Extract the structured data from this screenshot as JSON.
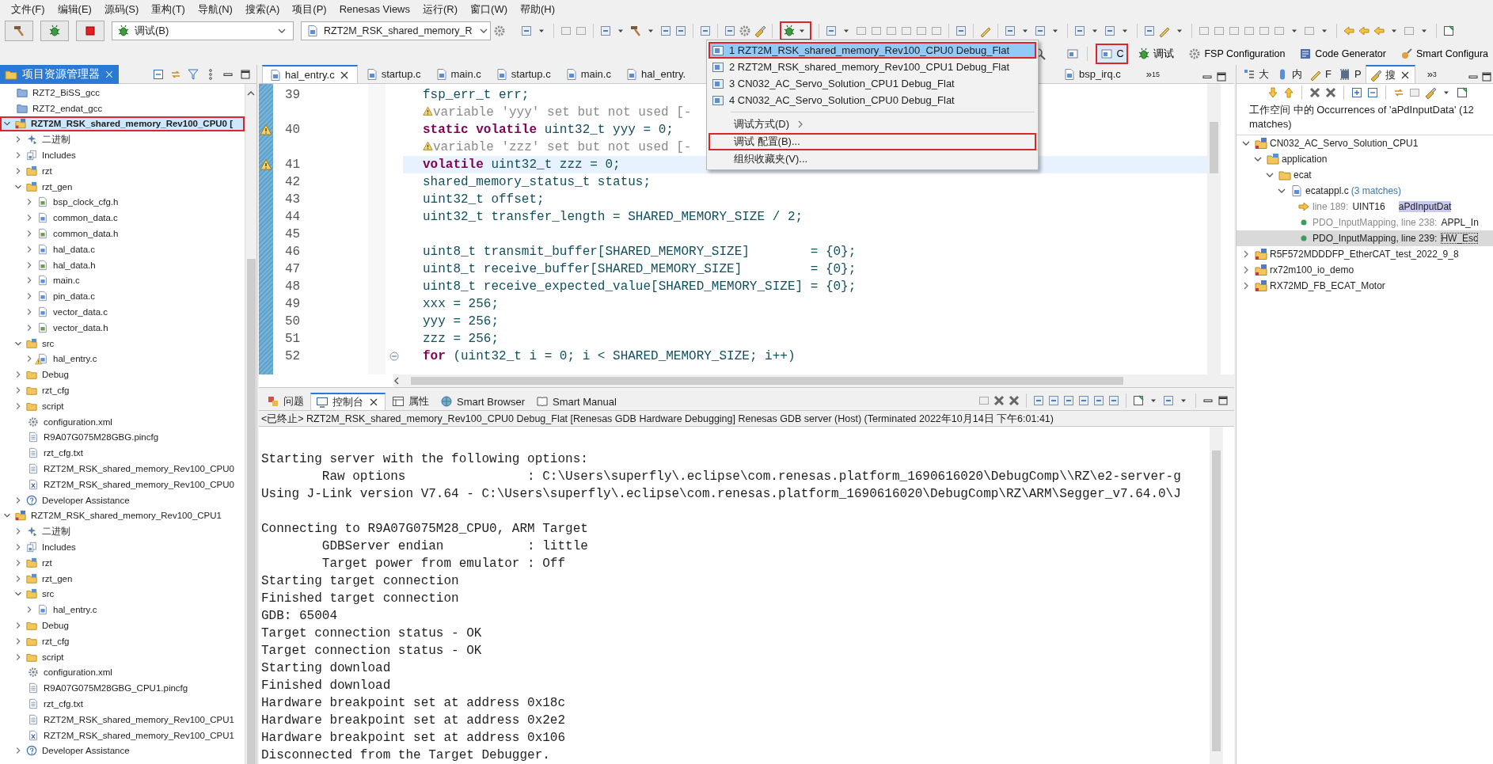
{
  "menu_bar": [
    "文件(F)",
    "编辑(E)",
    "源码(S)",
    "重构(T)",
    "导航(N)",
    "搜索(A)",
    "项目(P)",
    "Renesas Views",
    "运行(R)",
    "窗口(W)",
    "帮助(H)"
  ],
  "toolbar": {
    "launch_mode": "调试(B)",
    "launch_config": "RZT2M_RSK_shared_memory_R",
    "debug_annotated": true
  },
  "perspectives": [
    {
      "label": "C",
      "selected": true,
      "annotated": true
    },
    {
      "label": "调试",
      "selected": false,
      "annotated": false
    },
    {
      "label": "FSP Configuration",
      "selected": false,
      "annotated": false
    },
    {
      "label": "Code Generator",
      "selected": false,
      "annotated": false
    },
    {
      "label": "Smart Configura",
      "selected": false,
      "annotated": false
    }
  ],
  "project_explorer": {
    "title": "项目资源管理器",
    "items": [
      {
        "kind": "closed-project",
        "label": "RZT2_BiSS_gcc",
        "expandable": false,
        "selected": false,
        "annotated": false,
        "warning": false
      },
      {
        "kind": "closed-project",
        "label": "RZT2_endat_gcc",
        "expandable": false,
        "selected": false,
        "annotated": false,
        "warning": false
      },
      {
        "kind": "project",
        "label": "RZT2M_RSK_shared_memory_Rev100_CPU0 [",
        "expandable": true,
        "expanded": true,
        "selected": true,
        "annotated": true,
        "warning": false,
        "children": [
          {
            "kind": "binaries",
            "label": "二进制",
            "expandable": true,
            "expanded": false,
            "selected": false,
            "annotated": false,
            "warning": false
          },
          {
            "kind": "includes",
            "label": "Includes",
            "expandable": true,
            "expanded": false,
            "selected": false,
            "annotated": false,
            "warning": false
          },
          {
            "kind": "source-folder",
            "label": "rzt",
            "expandable": true,
            "expanded": false,
            "selected": false,
            "annotated": false,
            "warning": false
          },
          {
            "kind": "source-folder",
            "label": "rzt_gen",
            "expandable": true,
            "expanded": true,
            "selected": false,
            "annotated": false,
            "warning": false,
            "children": [
              {
                "kind": "h-file",
                "label": "bsp_clock_cfg.h",
                "expandable": true,
                "expanded": false,
                "selected": false,
                "annotated": false,
                "warning": false
              },
              {
                "kind": "c-file",
                "label": "common_data.c",
                "expandable": true,
                "expanded": false,
                "selected": false,
                "annotated": false,
                "warning": false
              },
              {
                "kind": "h-file",
                "label": "common_data.h",
                "expandable": true,
                "expanded": false,
                "selected": false,
                "annotated": false,
                "warning": false
              },
              {
                "kind": "c-file",
                "label": "hal_data.c",
                "expandable": true,
                "expanded": false,
                "selected": false,
                "annotated": false,
                "warning": false
              },
              {
                "kind": "h-file",
                "label": "hal_data.h",
                "expandable": true,
                "expanded": false,
                "selected": false,
                "annotated": false,
                "warning": false
              },
              {
                "kind": "c-file",
                "label": "main.c",
                "expandable": true,
                "expanded": false,
                "selected": false,
                "annotated": false,
                "warning": false
              },
              {
                "kind": "c-file",
                "label": "pin_data.c",
                "expandable": true,
                "expanded": false,
                "selected": false,
                "annotated": false,
                "warning": false
              },
              {
                "kind": "c-file",
                "label": "vector_data.c",
                "expandable": true,
                "expanded": false,
                "selected": false,
                "annotated": false,
                "warning": false
              },
              {
                "kind": "h-file",
                "label": "vector_data.h",
                "expandable": true,
                "expanded": false,
                "selected": false,
                "annotated": false,
                "warning": false
              }
            ]
          },
          {
            "kind": "source-folder",
            "label": "src",
            "expandable": true,
            "expanded": true,
            "selected": false,
            "annotated": false,
            "warning": false,
            "children": [
              {
                "kind": "c-file",
                "label": "hal_entry.c",
                "expandable": true,
                "expanded": false,
                "selected": false,
                "annotated": false,
                "warning": true
              }
            ]
          },
          {
            "kind": "folder",
            "label": "Debug",
            "expandable": true,
            "expanded": false,
            "selected": false,
            "annotated": false,
            "warning": false
          },
          {
            "kind": "folder",
            "label": "rzt_cfg",
            "expandable": true,
            "expanded": false,
            "selected": false,
            "annotated": false,
            "warning": false
          },
          {
            "kind": "folder",
            "label": "script",
            "expandable": true,
            "expanded": false,
            "selected": false,
            "annotated": false,
            "warning": false
          },
          {
            "kind": "settings-file",
            "label": "configuration.xml",
            "expandable": false,
            "selected": false,
            "annotated": false,
            "warning": false
          },
          {
            "kind": "text-file",
            "label": "R9A07G075M28GBG.pincfg",
            "expandable": false,
            "selected": false,
            "annotated": false,
            "warning": false
          },
          {
            "kind": "text-file",
            "label": "rzt_cfg.txt",
            "expandable": false,
            "selected": false,
            "annotated": false,
            "warning": false
          },
          {
            "kind": "text-file",
            "label": "RZT2M_RSK_shared_memory_Rev100_CPU0",
            "expandable": false,
            "selected": false,
            "annotated": false,
            "warning": false
          },
          {
            "kind": "xml-file",
            "label": "RZT2M_RSK_shared_memory_Rev100_CPU0",
            "expandable": false,
            "selected": false,
            "annotated": false,
            "warning": false
          },
          {
            "kind": "help",
            "label": "Developer Assistance",
            "expandable": true,
            "expanded": false,
            "selected": false,
            "annotated": false,
            "warning": false
          }
        ]
      },
      {
        "kind": "project",
        "label": "RZT2M_RSK_shared_memory_Rev100_CPU1",
        "expandable": true,
        "expanded": true,
        "selected": false,
        "annotated": false,
        "warning": false,
        "children": [
          {
            "kind": "binaries",
            "label": "二进制",
            "expandable": true,
            "expanded": false,
            "selected": false,
            "annotated": false,
            "warning": false
          },
          {
            "kind": "includes",
            "label": "Includes",
            "expandable": true,
            "expanded": false,
            "selected": false,
            "annotated": false,
            "warning": false
          },
          {
            "kind": "source-folder",
            "label": "rzt",
            "expandable": true,
            "expanded": false,
            "selected": false,
            "annotated": false,
            "warning": false
          },
          {
            "kind": "source-folder",
            "label": "rzt_gen",
            "expandable": true,
            "expanded": false,
            "selected": false,
            "annotated": false,
            "warning": false
          },
          {
            "kind": "source-folder",
            "label": "src",
            "expandable": true,
            "expanded": true,
            "selected": false,
            "annotated": false,
            "warning": false,
            "children": [
              {
                "kind": "c-file",
                "label": "hal_entry.c",
                "expandable": true,
                "expanded": false,
                "selected": false,
                "annotated": false,
                "warning": false
              }
            ]
          },
          {
            "kind": "folder",
            "label": "Debug",
            "expandable": true,
            "expanded": false,
            "selected": false,
            "annotated": false,
            "warning": false
          },
          {
            "kind": "folder",
            "label": "rzt_cfg",
            "expandable": true,
            "expanded": false,
            "selected": false,
            "annotated": false,
            "warning": false
          },
          {
            "kind": "folder",
            "label": "script",
            "expandable": true,
            "expanded": false,
            "selected": false,
            "annotated": false,
            "warning": false
          },
          {
            "kind": "settings-file",
            "label": "configuration.xml",
            "expandable": false,
            "selected": false,
            "annotated": false,
            "warning": false
          },
          {
            "kind": "text-file",
            "label": "R9A07G075M28GBG_CPU1.pincfg",
            "expandable": false,
            "selected": false,
            "annotated": false,
            "warning": false
          },
          {
            "kind": "text-file",
            "label": "rzt_cfg.txt",
            "expandable": false,
            "selected": false,
            "annotated": false,
            "warning": false
          },
          {
            "kind": "text-file",
            "label": "RZT2M_RSK_shared_memory_Rev100_CPU1",
            "expandable": false,
            "selected": false,
            "annotated": false,
            "warning": false
          },
          {
            "kind": "xml-file",
            "label": "RZT2M_RSK_shared_memory_Rev100_CPU1",
            "expandable": false,
            "selected": false,
            "annotated": false,
            "warning": false
          },
          {
            "kind": "help",
            "label": "Developer Assistance",
            "expandable": true,
            "expanded": false,
            "selected": false,
            "annotated": false,
            "warning": false
          }
        ]
      }
    ]
  },
  "editor": {
    "tabs": [
      {
        "label": "hal_entry.c",
        "selected": true
      },
      {
        "label": "startup.c",
        "selected": false
      },
      {
        "label": "main.c",
        "selected": false
      },
      {
        "label": "startup.c",
        "selected": false
      },
      {
        "label": "main.c",
        "selected": false
      },
      {
        "label": "hal_entry.",
        "selected": false
      },
      {
        "label": "bsp_irq.c",
        "selected": false
      }
    ],
    "overflow": "»",
    "overflow_count": "15",
    "lines": [
      {
        "kind": "code",
        "number": "39",
        "text": "fsp_err_t err;",
        "warning": false,
        "current": false,
        "foldable": false
      },
      {
        "kind": "annotation",
        "text": "variable 'yyy' set but not used [-"
      },
      {
        "kind": "code",
        "number": "40",
        "text": "**static volatile** uint32_t yyy = 0;",
        "warning": true,
        "current": false,
        "foldable": false
      },
      {
        "kind": "annotation",
        "text": "variable 'zzz' set but not used [-"
      },
      {
        "kind": "code",
        "number": "41",
        "text": "**volatile** uint32_t zzz = 0;",
        "warning": true,
        "current": true,
        "foldable": false
      },
      {
        "kind": "code",
        "number": "42",
        "text": "shared_memory_status_t status;",
        "warning": false,
        "current": false,
        "foldable": false
      },
      {
        "kind": "code",
        "number": "43",
        "text": "uint32_t offset;",
        "warning": false,
        "current": false,
        "foldable": false
      },
      {
        "kind": "code",
        "number": "44",
        "text": "uint32_t transfer_length = SHARED_MEMORY_SIZE / 2;",
        "warning": false,
        "current": false,
        "foldable": false
      },
      {
        "kind": "code",
        "number": "45",
        "warning": false,
        "current": false,
        "foldable": false
      },
      {
        "kind": "code",
        "number": "46",
        "text": "uint8_t transmit_buffer[SHARED_MEMORY_SIZE]        = {0};",
        "warning": false,
        "current": false,
        "foldable": false
      },
      {
        "kind": "code",
        "number": "47",
        "text": "uint8_t receive_buffer[SHARED_MEMORY_SIZE]         = {0};",
        "warning": false,
        "current": false,
        "foldable": false
      },
      {
        "kind": "code",
        "number": "48",
        "text": "uint8_t receive_expected_value[SHARED_MEMORY_SIZE] = {0};",
        "warning": false,
        "current": false,
        "foldable": false
      },
      {
        "kind": "code",
        "number": "49",
        "text": "xxx = 256;",
        "warning": false,
        "current": false,
        "foldable": false
      },
      {
        "kind": "code",
        "number": "50",
        "text": "yyy = 256;",
        "warning": false,
        "current": false,
        "foldable": false
      },
      {
        "kind": "code",
        "number": "51",
        "text": "zzz = 256;",
        "warning": false,
        "current": false,
        "foldable": false
      },
      {
        "kind": "code",
        "number": "52",
        "text": "**for** (uint32_t i = 0; i < SHARED_MEMORY_SIZE; i++)",
        "warning": false,
        "current": false,
        "foldable": true
      }
    ]
  },
  "launch_menu": {
    "configs": [
      {
        "label": "1 RZT2M_RSK_shared_memory_Rev100_CPU0 Debug_Flat",
        "selected": true,
        "annotated": true
      },
      {
        "label": "2 RZT2M_RSK_shared_memory_Rev100_CPU1 Debug_Flat",
        "selected": false,
        "annotated": false
      },
      {
        "label": "3 CN032_AC_Servo_Solution_CPU1 Debug_Flat",
        "selected": false,
        "annotated": false
      },
      {
        "label": "4 CN032_AC_Servo_Solution_CPU0 Debug_Flat",
        "selected": false,
        "annotated": false
      }
    ],
    "commands": [
      {
        "kind": "submenu",
        "label": "调试方式(D)",
        "selected": false,
        "annotated": false
      },
      {
        "kind": "command",
        "label": "调试 配置(B)...",
        "selected": false,
        "annotated": true
      },
      {
        "kind": "command",
        "label": "组织收藏夹(V)...",
        "selected": false,
        "annotated": false
      }
    ]
  },
  "console": {
    "tabs": [
      {
        "kind": "problems",
        "label": "问题",
        "selected": false
      },
      {
        "kind": "console",
        "label": "控制台",
        "selected": true
      },
      {
        "kind": "properties",
        "label": "属性",
        "selected": false
      },
      {
        "kind": "browser",
        "label": "Smart Browser",
        "selected": false
      },
      {
        "kind": "manual",
        "label": "Smart Manual",
        "selected": false
      }
    ],
    "header": "<已终止> RZT2M_RSK_shared_memory_Rev100_CPU0 Debug_Flat [Renesas GDB Hardware Debugging] Renesas GDB server (Host) (Terminated 2022年10月14日 下午6:01:41)",
    "lines": [
      {
        "kind": "blank"
      },
      {
        "kind": "output",
        "text": "Starting server with the following options:"
      },
      {
        "kind": "output",
        "text": "\tRaw options                : C:\\Users\\superfly\\.eclipse\\com.renesas.platform_1690616020\\DebugComp\\\\RZ\\e2-server-g"
      },
      {
        "kind": "output",
        "text": "Using J-Link version V7.64 - C:\\Users\\superfly\\.eclipse\\com.renesas.platform_1690616020\\DebugComp\\RZ\\ARM\\Segger_v7.64.0\\J"
      },
      {
        "kind": "blank"
      },
      {
        "kind": "output",
        "text": "Connecting to R9A07G075M28_CPU0, ARM Target"
      },
      {
        "kind": "output",
        "text": "\tGDBServer endian           : little"
      },
      {
        "kind": "output",
        "text": "\tTarget power from emulator : Off"
      },
      {
        "kind": "output",
        "text": "Starting target connection"
      },
      {
        "kind": "output",
        "text": "Finished target connection"
      },
      {
        "kind": "output",
        "text": "GDB: 65004"
      },
      {
        "kind": "output",
        "text": "Target connection status - OK"
      },
      {
        "kind": "output",
        "text": "Target connection status - OK"
      },
      {
        "kind": "output",
        "text": "Starting download"
      },
      {
        "kind": "output",
        "text": "Finished download"
      },
      {
        "kind": "output",
        "text": "Hardware breakpoint set at address 0x18c"
      },
      {
        "kind": "output",
        "text": "Hardware breakpoint set at address 0x2e2"
      },
      {
        "kind": "output",
        "text": "Hardware breakpoint set at address 0x106"
      },
      {
        "kind": "output",
        "text": "Disconnected from the Target Debugger."
      }
    ]
  },
  "search_view": {
    "tabs": [
      {
        "kind": "outline",
        "label": "大",
        "selected": false
      },
      {
        "kind": "memory",
        "label": "内",
        "selected": false
      },
      {
        "kind": "fsp",
        "label": "F",
        "selected": false
      },
      {
        "kind": "pins",
        "label": "P",
        "selected": false
      },
      {
        "kind": "search",
        "label": "搜",
        "selected": true
      }
    ],
    "overflow": "»",
    "overflow_count": "3",
    "summary": "工作空间 中的 Occurrences of 'aPdInputData' (12 matches)",
    "results": [
      {
        "kind": "project",
        "label": "CN032_AC_Servo_Solution_CPU1",
        "expanded": true,
        "selected": false,
        "children": [
          {
            "kind": "source-folder",
            "label": "application",
            "expanded": true,
            "selected": false,
            "children": [
              {
                "kind": "folder",
                "label": "ecat",
                "expanded": true,
                "selected": false,
                "children": [
                  {
                    "kind": "c-file",
                    "label": "ecatappl.c",
                    "count": "(3 matches)",
                    "expanded": true,
                    "selected": false,
                    "children": [
                      {
                        "kind": "line-match",
                        "location": "line 189:",
                        "code": "UINT16",
                        "match": "aPdInputDat",
                        "selected": false
                      },
                      {
                        "kind": "function-match",
                        "location": "PDO_InputMapping, line 238:",
                        "code": "APPL_In",
                        "selected": false
                      },
                      {
                        "kind": "function-match",
                        "location": "PDO_InputMapping, line 239:",
                        "code": "HW_Esc",
                        "selected": true
                      }
                    ]
                  }
                ]
              }
            ]
          }
        ]
      },
      {
        "kind": "project",
        "label": "R5F572MDDDFP_EtherCAT_test_2022_9_8",
        "expanded": false,
        "selected": false
      },
      {
        "kind": "project",
        "label": "rx72m100_io_demo",
        "expanded": false,
        "selected": false
      },
      {
        "kind": "project",
        "label": "RX72MD_FB_ECAT_Motor",
        "expanded": false,
        "selected": false
      }
    ]
  }
}
